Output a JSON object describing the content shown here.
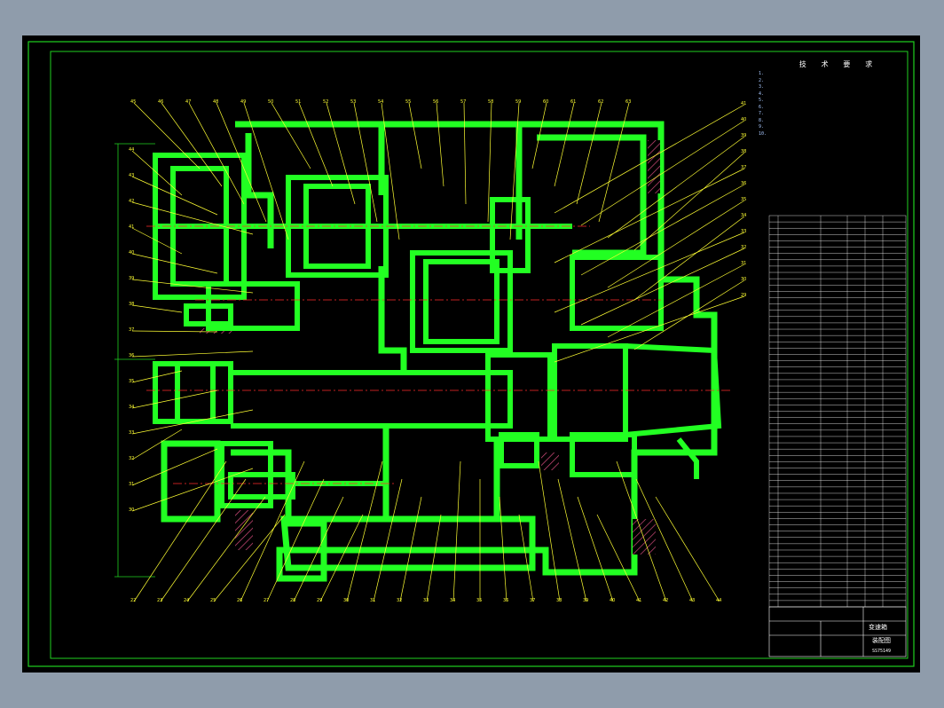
{
  "colors": {
    "viewport_bg": "#8f9cab",
    "sheet_bg": "#000000",
    "border": "#1fd01f",
    "part_fill": "#22ff22",
    "leader": "#ffff33",
    "centerline": "#ff2a2a",
    "hatch": "#d04a7a",
    "notes_text": "#a8c8ff",
    "table_line": "#ffffff"
  },
  "notes": {
    "title": "技 术 要 求",
    "lines": [
      "1. ",
      "2. ",
      "3. ",
      "4. ",
      "5. ",
      "6. ",
      "7. ",
      "8. ",
      "9. ",
      "10. "
    ]
  },
  "title_block": {
    "title": "变速箱",
    "drawing": "装配图",
    "code": "SS75149"
  },
  "balloons": {
    "top": [
      "45",
      "46",
      "47",
      "48",
      "49",
      "50",
      "51",
      "52",
      "53",
      "54",
      "55",
      "56",
      "57",
      "58",
      "59",
      "60",
      "61",
      "62",
      "63"
    ],
    "right": [
      "41",
      "40",
      "39",
      "38",
      "37",
      "36",
      "35",
      "34",
      "33",
      "32",
      "31",
      "30",
      "29"
    ],
    "left": [
      "44",
      "43",
      "42",
      "41",
      "40",
      "39",
      "38",
      "37",
      "36",
      "35",
      "34",
      "33",
      "32",
      "31",
      "30"
    ],
    "bottom": [
      "22",
      "23",
      "24",
      "25",
      "26",
      "27",
      "28",
      "29",
      "30",
      "31",
      "32",
      "33",
      "34",
      "35",
      "36",
      "37",
      "38",
      "39",
      "40",
      "41",
      "42",
      "43",
      "44"
    ]
  }
}
